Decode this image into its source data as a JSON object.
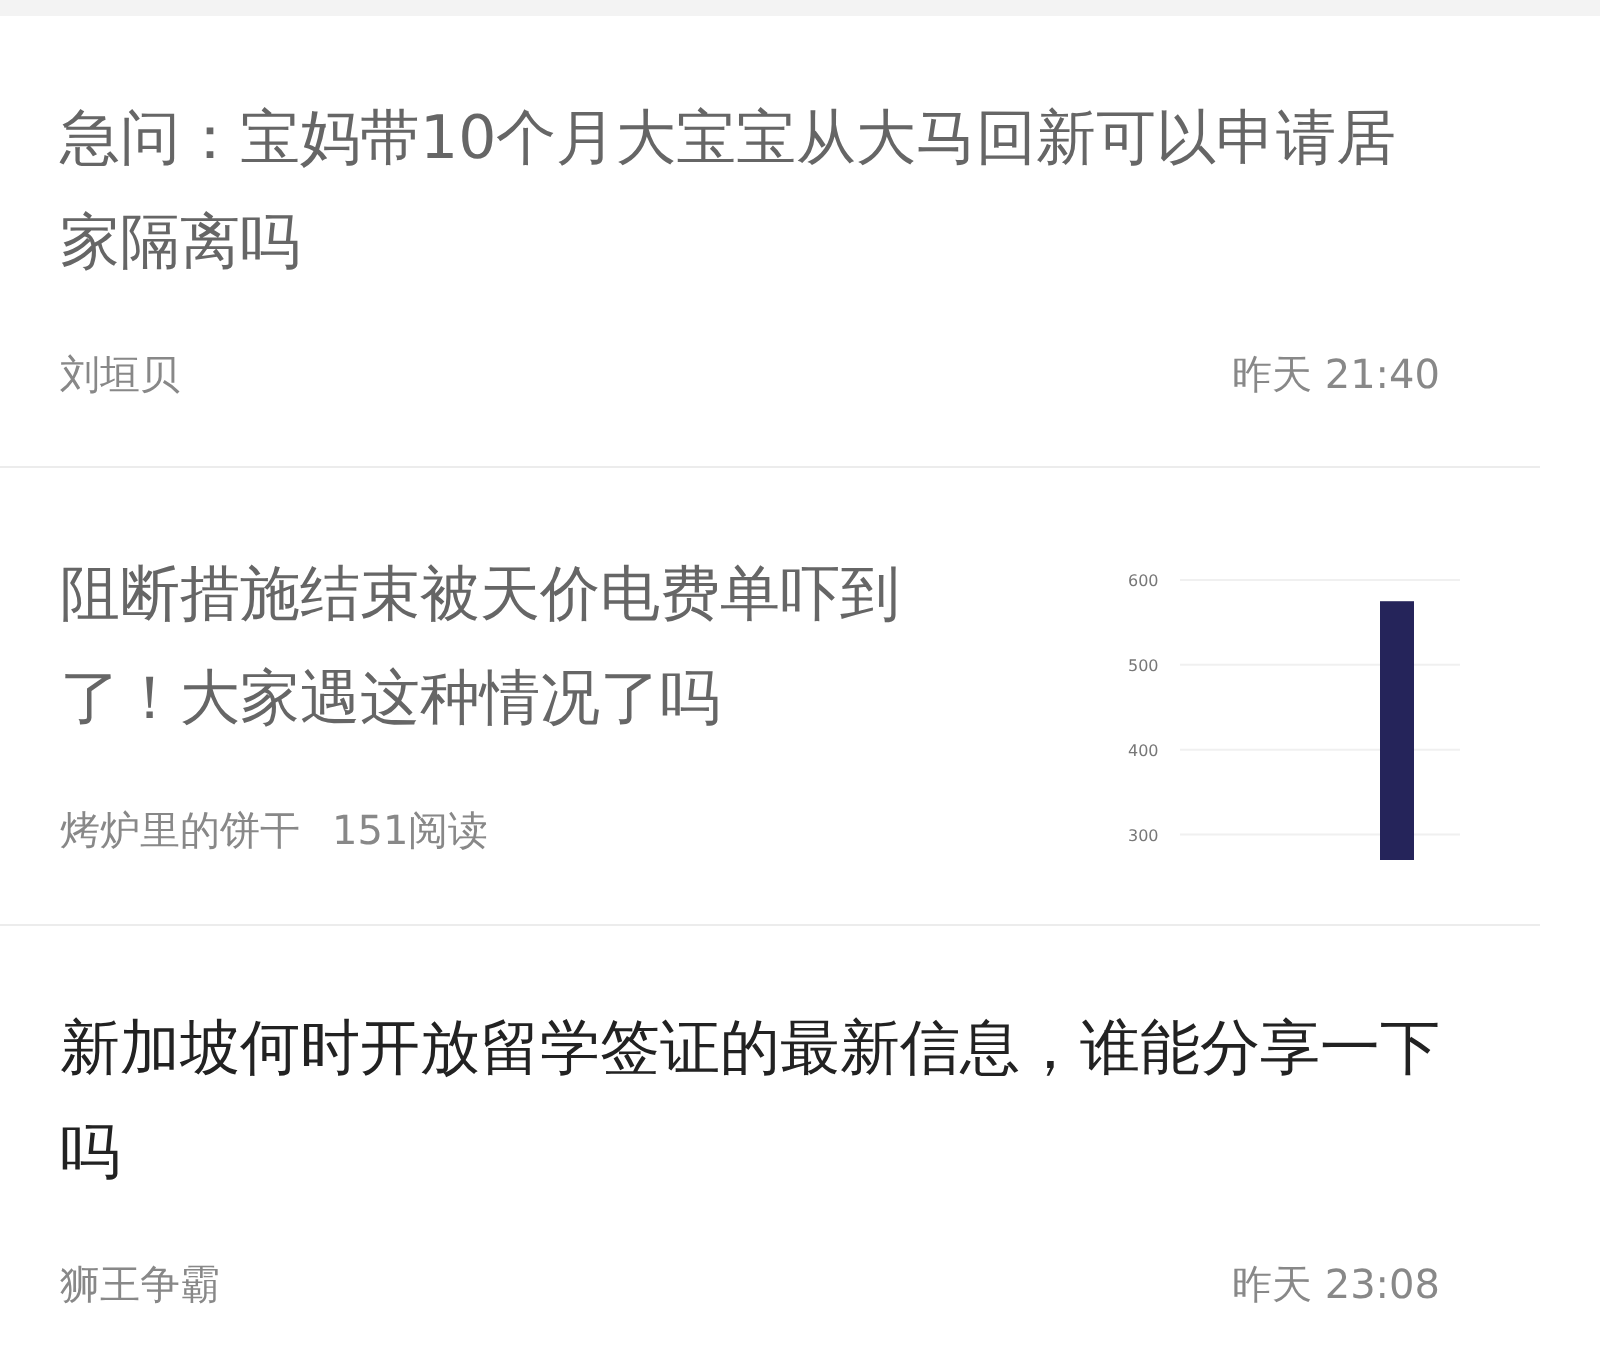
{
  "posts": [
    {
      "title": "急问：宝妈带10个月大宝宝从大马回新可以申请居家隔离吗",
      "read": true,
      "author": "刘垣贝",
      "time": "昨天 21:40"
    },
    {
      "title": "阻断措施结束被天价电费单吓到了！大家遇这种情况了吗",
      "read": true,
      "author": "烤炉里的饼干",
      "views": "151阅读",
      "thumbnail": {
        "chart_data": {
          "type": "bar",
          "values": [
            575
          ],
          "ylim": [
            270,
            600
          ],
          "yticks": [
            300,
            400,
            500,
            600
          ],
          "grid": true,
          "color": "#25245a"
        }
      }
    },
    {
      "title": "新加坡何时开放留学签证的最新信息，谁能分享一下吗",
      "read": false,
      "author": "狮王争霸",
      "time": "昨天 23:08"
    }
  ]
}
